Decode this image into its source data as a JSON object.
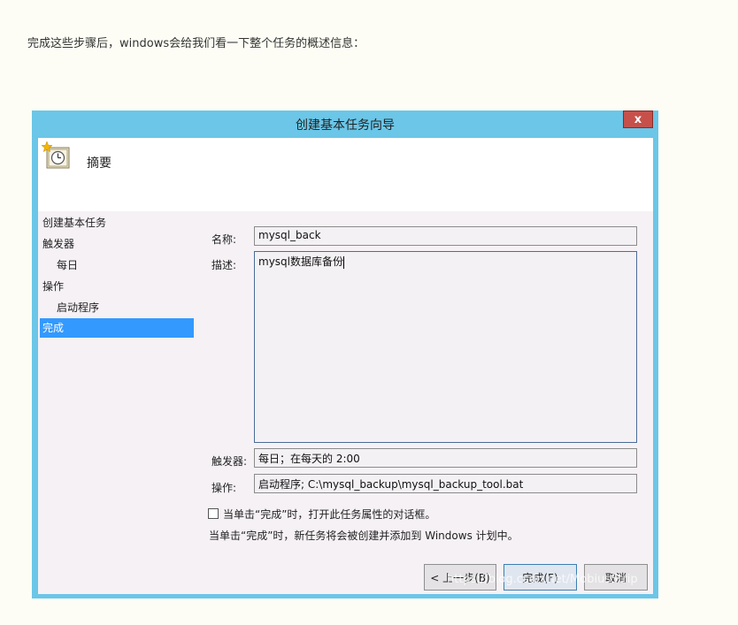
{
  "intro_text": "完成这些步骤后，windows会给我们看一下整个任务的概述信息：",
  "dialog": {
    "title": "创建基本任务向导",
    "close_symbol": "x",
    "header_title": "摘要"
  },
  "nav": {
    "items": [
      {
        "label": "创建基本任务"
      },
      {
        "label": "触发器"
      },
      {
        "label": "每日"
      },
      {
        "label": "操作"
      },
      {
        "label": "启动程序"
      },
      {
        "label": "完成"
      }
    ]
  },
  "form": {
    "name_label": "名称:",
    "name_value": "mysql_back",
    "desc_label": "描述:",
    "desc_value": "mysql数据库备份",
    "trigger_label": "触发器:",
    "trigger_value": "每日；在每天的 2:00",
    "action_label": "操作:",
    "action_value": "启动程序; C:\\mysql_backup\\mysql_backup_tool.bat"
  },
  "checkbox_label": "当单击“完成”时，打开此任务属性的对话框。",
  "info_text": "当单击“完成”时，新任务将会被创建并添加到 Windows 计划中。",
  "buttons": {
    "back": "< 上一步(B)",
    "finish": "完成(F)",
    "cancel": "取消"
  },
  "watermark": "https://blog.csdn.net/MobiusStrip",
  "colors": {
    "frame": "#6bc6e8",
    "selection": "#3399ff",
    "close": "#c7504a"
  }
}
